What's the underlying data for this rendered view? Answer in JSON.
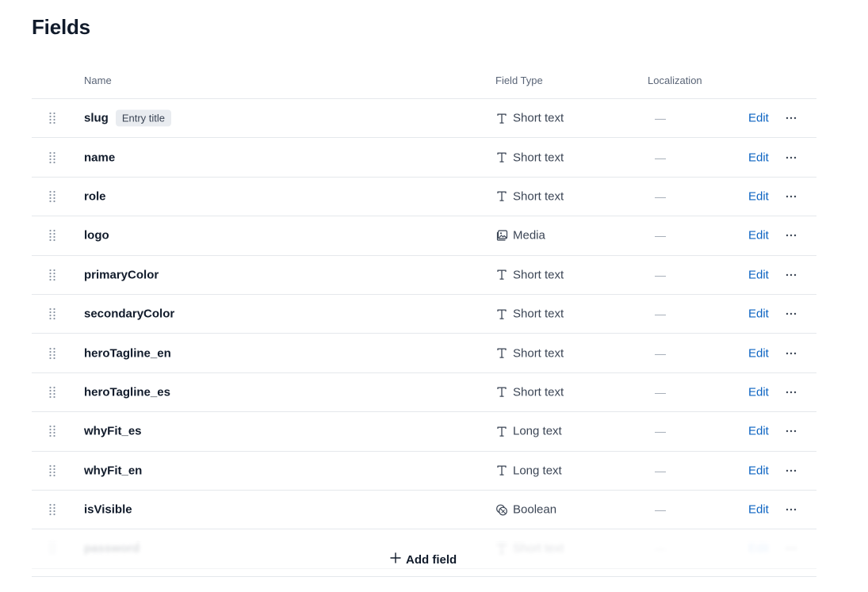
{
  "page": {
    "title": "Fields"
  },
  "columns": {
    "name": "Name",
    "type": "Field Type",
    "localization": "Localization"
  },
  "rows": [
    {
      "name": "slug",
      "badge": "Entry title",
      "type": "Short text",
      "type_icon": "text-icon",
      "localization": "—",
      "edit": "Edit"
    },
    {
      "name": "name",
      "badge": "",
      "type": "Short text",
      "type_icon": "text-icon",
      "localization": "—",
      "edit": "Edit"
    },
    {
      "name": "role",
      "badge": "",
      "type": "Short text",
      "type_icon": "text-icon",
      "localization": "—",
      "edit": "Edit"
    },
    {
      "name": "logo",
      "badge": "",
      "type": "Media",
      "type_icon": "media-icon",
      "localization": "—",
      "edit": "Edit"
    },
    {
      "name": "primaryColor",
      "badge": "",
      "type": "Short text",
      "type_icon": "text-icon",
      "localization": "—",
      "edit": "Edit"
    },
    {
      "name": "secondaryColor",
      "badge": "",
      "type": "Short text",
      "type_icon": "text-icon",
      "localization": "—",
      "edit": "Edit"
    },
    {
      "name": "heroTagline_en",
      "badge": "",
      "type": "Short text",
      "type_icon": "text-icon",
      "localization": "—",
      "edit": "Edit"
    },
    {
      "name": "heroTagline_es",
      "badge": "",
      "type": "Short text",
      "type_icon": "text-icon",
      "localization": "—",
      "edit": "Edit"
    },
    {
      "name": "whyFit_es",
      "badge": "",
      "type": "Long text",
      "type_icon": "text-icon",
      "localization": "—",
      "edit": "Edit"
    },
    {
      "name": "whyFit_en",
      "badge": "",
      "type": "Long text",
      "type_icon": "text-icon",
      "localization": "—",
      "edit": "Edit"
    },
    {
      "name": "isVisible",
      "badge": "",
      "type": "Boolean",
      "type_icon": "boolean-icon",
      "localization": "—",
      "edit": "Edit"
    },
    {
      "name": "password",
      "badge": "",
      "type": "Short text",
      "type_icon": "text-icon",
      "localization": "—",
      "edit": "Edit",
      "faded": true
    }
  ],
  "add_field": {
    "label": "Add field",
    "icon": "plus-icon"
  },
  "colors": {
    "link": "#0b63c2",
    "text": "#111b2b",
    "muted": "#5a6577",
    "border": "#e5e8ec",
    "badge_bg": "#e9ecf0"
  }
}
